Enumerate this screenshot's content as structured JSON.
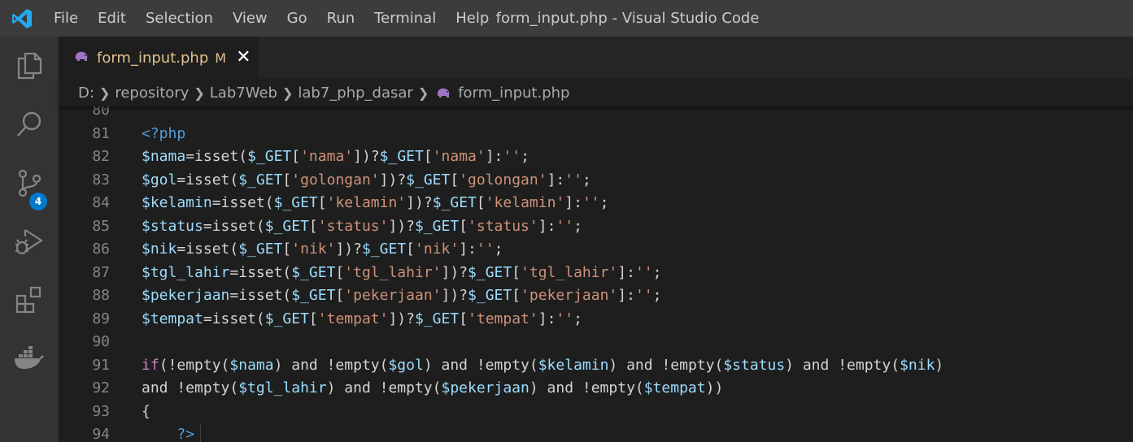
{
  "window": {
    "title": "form_input.php - Visual Studio Code",
    "menu": [
      "File",
      "Edit",
      "Selection",
      "View",
      "Go",
      "Run",
      "Terminal",
      "Help"
    ]
  },
  "activity_bar": {
    "items": [
      "explorer-icon",
      "search-icon",
      "source-control-icon",
      "run-debug-icon",
      "extensions-icon",
      "docker-icon"
    ],
    "source_control_badge": "4"
  },
  "tab": {
    "label": "form_input.php",
    "status": "M",
    "close": "✕"
  },
  "breadcrumb": [
    "D:",
    "repository",
    "Lab7Web",
    "lab7_php_dasar",
    "form_input.php"
  ],
  "colors": {
    "accent": "#007acc",
    "modified": "#e2c08d",
    "variable": "#9cdcfe",
    "string": "#ce9178",
    "keyword": "#c586c0",
    "tag": "#569cd6"
  },
  "code_lines": [
    {
      "n": "80",
      "text": ""
    },
    {
      "n": "81",
      "text": "<?php"
    },
    {
      "n": "82",
      "text": "$nama=isset($_GET['nama'])?$_GET['nama']:'';"
    },
    {
      "n": "83",
      "text": "$gol=isset($_GET['golongan'])?$_GET['golongan']:'';"
    },
    {
      "n": "84",
      "text": "$kelamin=isset($_GET['kelamin'])?$_GET['kelamin']:'';"
    },
    {
      "n": "85",
      "text": "$status=isset($_GET['status'])?$_GET['status']:'';"
    },
    {
      "n": "86",
      "text": "$nik=isset($_GET['nik'])?$_GET['nik']:'';"
    },
    {
      "n": "87",
      "text": "$tgl_lahir=isset($_GET['tgl_lahir'])?$_GET['tgl_lahir']:'';"
    },
    {
      "n": "88",
      "text": "$pekerjaan=isset($_GET['pekerjaan'])?$_GET['pekerjaan']:'';"
    },
    {
      "n": "89",
      "text": "$tempat=isset($_GET['tempat'])?$_GET['tempat']:'';"
    },
    {
      "n": "90",
      "text": ""
    },
    {
      "n": "91",
      "text": "if(!empty($nama) and !empty($gol) and !empty($kelamin) and !empty($status) and !empty($nik)"
    },
    {
      "n": "92",
      "text": "and !empty($tgl_lahir) and !empty($pekerjaan) and !empty($tempat))"
    },
    {
      "n": "93",
      "text": "{"
    },
    {
      "n": "94",
      "text": "    ?>"
    }
  ]
}
